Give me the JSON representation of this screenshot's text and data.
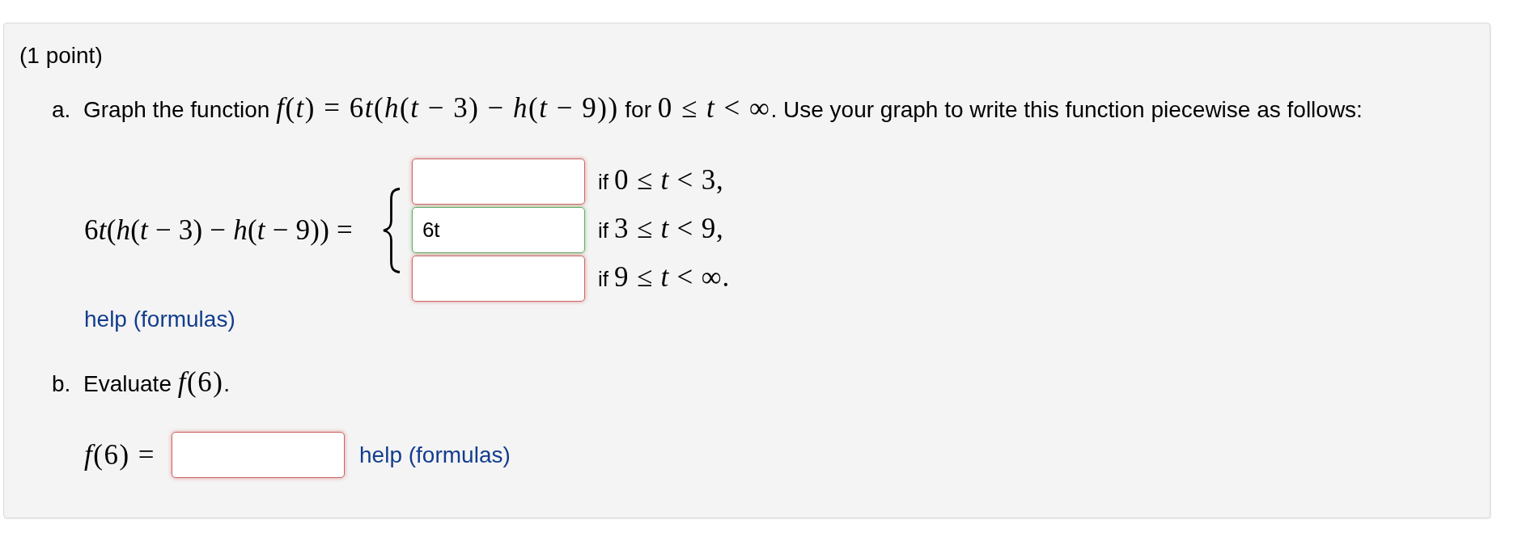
{
  "problem": {
    "points": "(1 point)",
    "part_a": {
      "label": "a.",
      "prompt": [
        {
          "kind": "text",
          "text": "Graph the function "
        },
        {
          "kind": "math",
          "text": "f(t) = 6t(h(t − 3) − h(t − 9))"
        },
        {
          "kind": "text",
          "text": " for "
        },
        {
          "kind": "math",
          "text": "0 ≤ t < ∞"
        },
        {
          "kind": "text",
          "text": ". Use your graph to write this function piecewise as follows:"
        }
      ],
      "piecewise": {
        "lhs": "6t(h(t − 3) − h(t − 9)) =",
        "pieces": [
          {
            "answer": {
              "correct": false
            },
            "condition": [
              {
                "kind": "text",
                "text": "if "
              },
              {
                "kind": "math",
                "text": "0 ≤ t < 3,"
              }
            ]
          },
          {
            "answer": {
              "value": "6t",
              "correct": true
            },
            "condition": [
              {
                "kind": "text",
                "text": "if "
              },
              {
                "kind": "math",
                "text": "3 ≤ t < 9,"
              }
            ]
          },
          {
            "answer": {
              "correct": false
            },
            "condition": [
              {
                "kind": "text",
                "text": "if "
              },
              {
                "kind": "math",
                "text": "9 ≤ t < ∞."
              }
            ]
          }
        ]
      },
      "help_link": "help (formulas)"
    },
    "part_b": {
      "label": "b.",
      "prompt": [
        {
          "kind": "text",
          "text": "Evaluate "
        },
        {
          "kind": "math",
          "text": "f(6)"
        },
        {
          "kind": "text",
          "text": "."
        }
      ],
      "answer_row": {
        "lhs": "f(6) =",
        "answer": {
          "correct": false
        },
        "help_link": "help (formulas)"
      }
    }
  }
}
